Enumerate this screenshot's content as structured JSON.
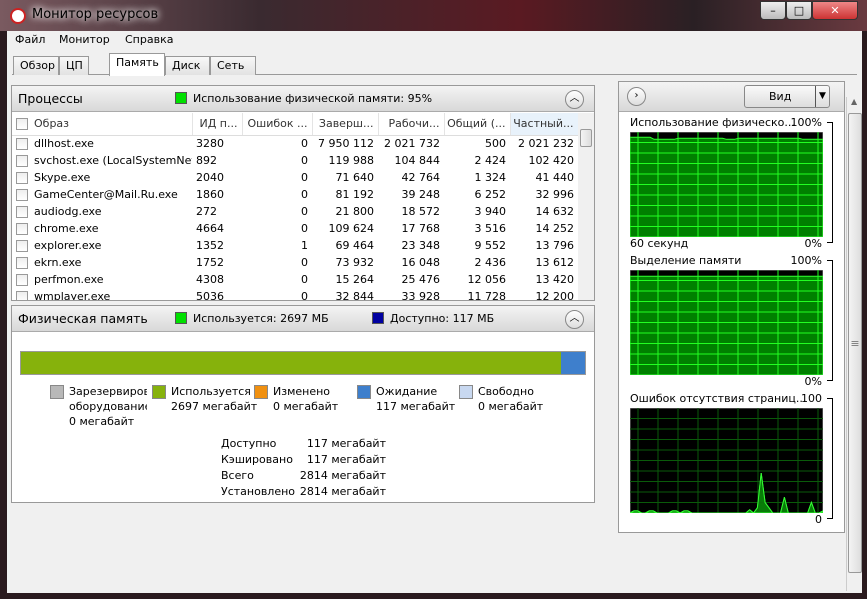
{
  "window": {
    "title": "Монитор ресурсов",
    "min": "–",
    "max": "□",
    "close": "✕"
  },
  "menu": [
    "Файл",
    "Монитор",
    "Справка"
  ],
  "tabs": [
    "Обзор",
    "ЦП",
    "Память",
    "Диск",
    "Сеть"
  ],
  "processes": {
    "title": "Процессы",
    "indicator": "Использование физической памяти: 95%",
    "indicator_color": "#00e000",
    "columns": [
      "Образ",
      "ИД п...",
      "Ошибок ...",
      "Заверш...",
      "Рабочи...",
      "Общий (...",
      "Частный..."
    ],
    "rows": [
      [
        "dllhost.exe",
        "3280",
        "0",
        "7 950 112",
        "2 021 732",
        "500",
        "2 021 232"
      ],
      [
        "svchost.exe (LocalSystemNet...",
        "892",
        "0",
        "119 988",
        "104 844",
        "2 424",
        "102 420"
      ],
      [
        "Skype.exe",
        "2040",
        "0",
        "71 640",
        "42 764",
        "1 324",
        "41 440"
      ],
      [
        "GameCenter@Mail.Ru.exe",
        "1860",
        "0",
        "81 192",
        "39 248",
        "6 252",
        "32 996"
      ],
      [
        "audiodg.exe",
        "272",
        "0",
        "21 800",
        "18 572",
        "3 940",
        "14 632"
      ],
      [
        "chrome.exe",
        "4664",
        "0",
        "109 624",
        "17 768",
        "3 516",
        "14 252"
      ],
      [
        "explorer.exe",
        "1352",
        "1",
        "69 464",
        "23 348",
        "9 552",
        "13 796"
      ],
      [
        "ekrn.exe",
        "1752",
        "0",
        "73 932",
        "16 048",
        "2 436",
        "13 612"
      ],
      [
        "perfmon.exe",
        "4308",
        "0",
        "15 264",
        "25 476",
        "12 056",
        "13 420"
      ],
      [
        "wmplayer.exe",
        "5036",
        "0",
        "32 844",
        "33 928",
        "11 728",
        "12 200"
      ]
    ]
  },
  "physical": {
    "title": "Физическая память",
    "used_label": "Используется: 2697 МБ",
    "used_color": "#00e000",
    "avail_label": "Доступно: 117 МБ",
    "avail_color": "#0000a0",
    "bar": {
      "used_fraction": 0.958,
      "used_color": "#86b20c",
      "standby_color": "#3e7fcc"
    },
    "legend": [
      {
        "l1": "Зарезервировано",
        "l2": "оборудование",
        "l3": "0 мегабайт",
        "color": "#b8b8b8"
      },
      {
        "l1": "Используется",
        "l2": "2697 мегабайт",
        "color": "#86b20c"
      },
      {
        "l1": "Изменено",
        "l2": "0 мегабайт",
        "color": "#f09010"
      },
      {
        "l1": "Ожидание",
        "l2": "117 мегабайт",
        "color": "#3e7fcc"
      },
      {
        "l1": "Свободно",
        "l2": "0 мегабайт",
        "color": "#c8d8f0"
      }
    ],
    "stats": [
      {
        "k": "Доступно",
        "v": "117 мегабайт"
      },
      {
        "k": "Кэшировано",
        "v": "117 мегабайт"
      },
      {
        "k": "Всего",
        "v": "2814 мегабайт"
      },
      {
        "k": "Установлено",
        "v": "2814 мегабайт"
      }
    ]
  },
  "right": {
    "view_label": "Вид",
    "graphs": [
      {
        "title": "Использование физическо...",
        "max": "100%",
        "min": "0%",
        "xlabel": "60 секунд",
        "values": [
          95,
          95,
          95,
          95,
          95,
          95,
          93,
          93,
          93,
          93,
          93,
          93,
          94,
          94,
          94,
          94,
          94,
          94,
          94,
          94,
          94,
          94,
          94,
          94,
          93,
          93,
          93,
          94,
          94,
          94,
          94,
          94,
          94,
          94,
          94,
          94,
          94,
          94,
          94,
          94,
          94,
          94,
          94,
          93,
          93,
          93,
          93,
          93,
          93
        ]
      },
      {
        "title": "Выделение памяти",
        "max": "100%",
        "min": "0%",
        "xlabel": "",
        "values": [
          94,
          94,
          94,
          94,
          94,
          94,
          94,
          94,
          94,
          94,
          94,
          94,
          94,
          94,
          94,
          94,
          94,
          94,
          94,
          94,
          94,
          94,
          94,
          94,
          94,
          94,
          94,
          94,
          94,
          94,
          94,
          94,
          94,
          94,
          94,
          94,
          94,
          94,
          94,
          94,
          94,
          94,
          94,
          94,
          94,
          94,
          94,
          94,
          94
        ]
      },
      {
        "title": "Ошибок отсутствия страниц...",
        "max": "100",
        "min": "0",
        "xlabel": "",
        "values": [
          0,
          2,
          2,
          0,
          0,
          2,
          2,
          0,
          0,
          0,
          0,
          2,
          2,
          0,
          2,
          2,
          0,
          0,
          0,
          0,
          0,
          0,
          0,
          0,
          0,
          0,
          0,
          0,
          0,
          0,
          0,
          3,
          0,
          5,
          38,
          10,
          5,
          0,
          0,
          0,
          15,
          0,
          0,
          0,
          0,
          0,
          0,
          10,
          0,
          0,
          2
        ]
      }
    ]
  }
}
